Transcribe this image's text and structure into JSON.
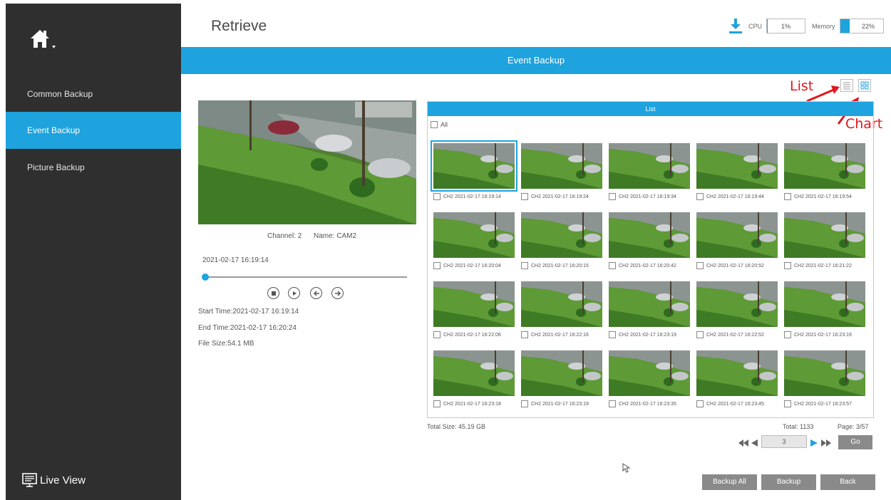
{
  "sidebar": {
    "items": [
      {
        "label": "Common Backup"
      },
      {
        "label": "Event Backup"
      },
      {
        "label": "Picture Backup"
      }
    ],
    "live_view": "Live View"
  },
  "header": {
    "title": "Retrieve",
    "cpu_label": "CPU",
    "cpu_value": "1%",
    "cpu_fraction": 0.01,
    "memory_label": "Memory",
    "memory_value": "22%",
    "memory_fraction": 0.22
  },
  "section_title": "Event Backup",
  "annotations": {
    "list": "List",
    "chart": "Chart"
  },
  "preview": {
    "channel": "Channel: 2",
    "name": "Name: CAM2",
    "timestamp": "2021-02-17 16:19:14",
    "start_time": "Start Time:2021-02-17 16:19:14",
    "end_time": "End Time:2021-02-17 16:20:24",
    "file_size": "File Size:54.1 MB"
  },
  "list": {
    "header": "List",
    "all_label": "All",
    "items": [
      "CH2  2021-02-17 16:19:14",
      "CH2  2021-02-17 16:19:24",
      "CH2  2021-02-17 16:19:34",
      "CH2  2021-02-17 16:19:44",
      "CH2  2021-02-17 16:19:54",
      "CH2  2021-02-17 16:20:04",
      "CH2  2021-02-17 16:20:15",
      "CH2  2021-02-17 16:20:42",
      "CH2  2021-02-17 16:20:52",
      "CH2  2021-02-17 16:21:22",
      "CH2  2021-02-17 16:22:06",
      "CH2  2021-02-17 16:22:16",
      "CH2  2021-02-17 16:23:19",
      "CH2  2021-02-17 16:22:52",
      "CH2  2021-02-17 16:23:19",
      "CH2  2021-02-17 16:23:18",
      "CH2  2021-02-17 16:23:19",
      "CH2  2021-02-17 16:23:35",
      "CH2  2021-02-17 16:23:45",
      "CH2  2021-02-17 16:23:57"
    ],
    "selected_index": 0
  },
  "footer": {
    "total_size": "Total Size: 45.19 GB",
    "total": "Total: 1133",
    "page": "Page: 3/57",
    "page_input": "3",
    "go": "Go"
  },
  "buttons": {
    "backup_all": "Backup All",
    "backup": "Backup",
    "back": "Back"
  },
  "colors": {
    "accent": "#1ea3de",
    "sidebar": "#2f2f2f",
    "annotation": "#e0171f"
  }
}
